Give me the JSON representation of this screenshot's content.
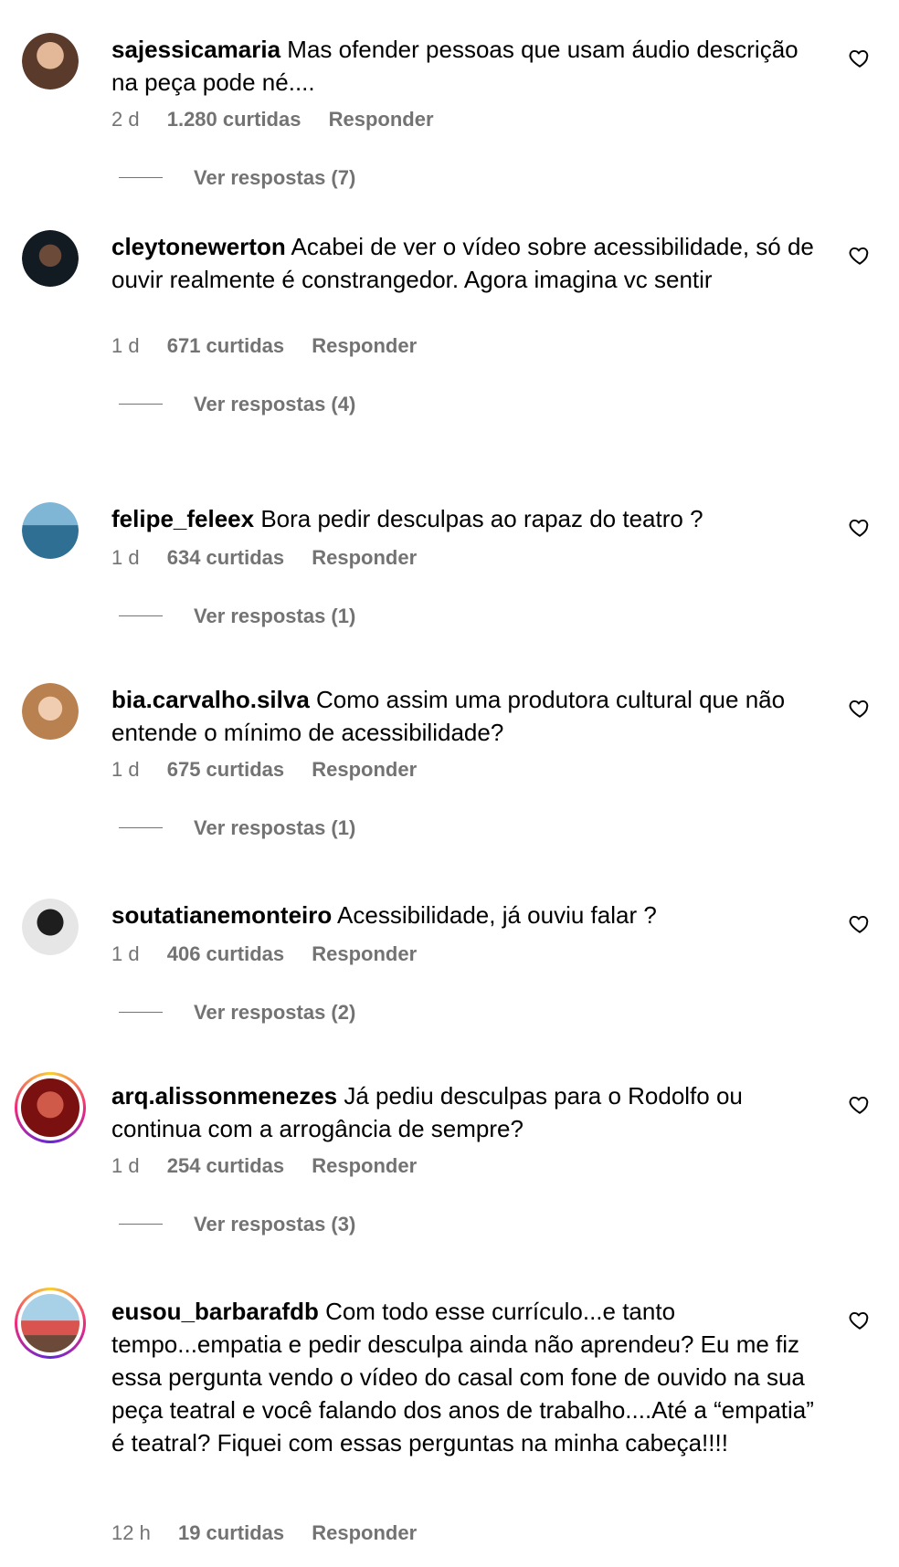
{
  "comments": [
    {
      "username": "sajessicamaria",
      "text": "Mas ofender pessoas que usam áudio descrição na peça pode né....",
      "time": "2 d",
      "likes": "1.280 curtidas",
      "reply": "Responder",
      "view_replies": "Ver respostas (7)",
      "avatar_color": "#8a6a55"
    },
    {
      "username": "cleytonewerton",
      "text": "Acabei de ver o vídeo sobre acessibilidade, só de ouvir realmente é constrangedor. Agora imagina vc sentir",
      "time": "1 d",
      "likes": "671 curtidas",
      "reply": "Responder",
      "view_replies": "Ver respostas (4)",
      "avatar_color": "#1c2a36"
    },
    {
      "username": "felipe_feleex",
      "text": "Bora pedir desculpas ao rapaz do teatro ?",
      "time": "1 d",
      "likes": "634 curtidas",
      "reply": "Responder",
      "view_replies": "Ver respostas (1)",
      "avatar_color": "#3f7fa6"
    },
    {
      "username": "bia.carvalho.silva",
      "text": "Como assim uma produtora cultural que não entende o mínimo de acessibilidade?",
      "time": "1 d",
      "likes": "675 curtidas",
      "reply": "Responder",
      "view_replies": "Ver respostas (1)",
      "avatar_color": "#c99a6e"
    },
    {
      "username": "soutatianemonteiro",
      "text": "Acessibilidade, já ouviu falar ?",
      "time": "1 d",
      "likes": "406 curtidas",
      "reply": "Responder",
      "view_replies": "Ver respostas (2)",
      "avatar_color": "#d9d9d9"
    },
    {
      "username": "arq.alissonmenezes",
      "text": "Já pediu desculpas para o Rodolfo ou continua com a arrogância de sempre?",
      "time": "1 d",
      "likes": "254 curtidas",
      "reply": "Responder",
      "view_replies": "Ver respostas (3)",
      "avatar_color": "#b22222"
    },
    {
      "username": "eusou_barbarafdb",
      "text": "Com todo esse currículo...e tanto tempo...empatia e pedir desculpa ainda não aprendeu? Eu me fiz essa pergunta vendo o vídeo do casal com fone de ouvido na sua peça teatral e você falando dos anos de trabalho....Até a “empatia” é teatral? Fiquei com essas perguntas na minha cabeça!!!!",
      "time": "12 h",
      "likes": "19 curtidas",
      "reply": "Responder",
      "avatar_color": "#c96a4a"
    }
  ],
  "colors": {
    "secondary_text": "#737373",
    "primary_text": "#000000"
  },
  "icons": {
    "like": "heart-outline-icon"
  }
}
